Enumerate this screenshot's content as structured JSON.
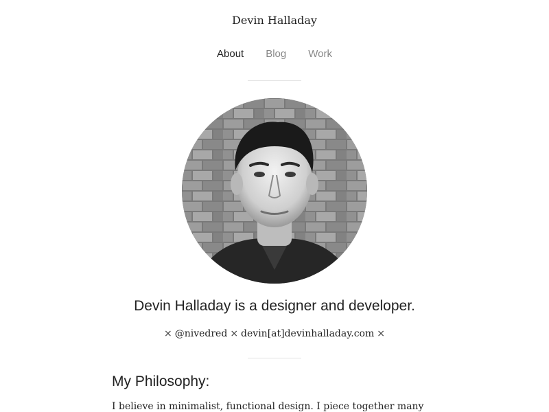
{
  "header": {
    "site_title": "Devin Halladay"
  },
  "nav": {
    "items": [
      {
        "label": "About",
        "active": true
      },
      {
        "label": "Blog",
        "active": false
      },
      {
        "label": "Work",
        "active": false
      }
    ]
  },
  "profile": {
    "headline": "Devin Halladay is a designer and developer.",
    "separator": "×",
    "twitter": "@nivedred",
    "email": "devin[at]devinhalladay.com"
  },
  "philosophy": {
    "title": "My Philosophy:",
    "body": "I believe in minimalist, functional design. I piece together many small"
  },
  "colors": {
    "text": "#222222",
    "nav_inactive": "#888888",
    "divider": "#e2e2e2",
    "background": "#ffffff"
  }
}
